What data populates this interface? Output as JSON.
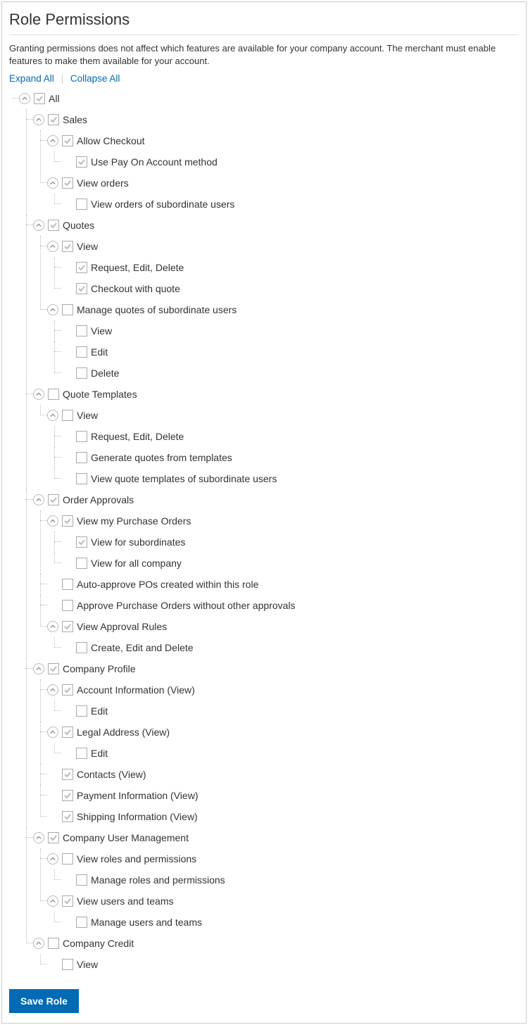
{
  "title": "Role Permissions",
  "description": "Granting permissions does not affect which features are available for your company account. The merchant must enable features to make them available for your account.",
  "toolbar": {
    "expand": "Expand All",
    "collapse": "Collapse All"
  },
  "save_label": "Save Role",
  "tree": [
    {
      "label": "All",
      "checked": true,
      "expandable": true,
      "children": [
        {
          "label": "Sales",
          "checked": true,
          "expandable": true,
          "children": [
            {
              "label": "Allow Checkout",
              "checked": true,
              "expandable": true,
              "children": [
                {
                  "label": "Use Pay On Account method",
                  "checked": true
                }
              ]
            },
            {
              "label": "View orders",
              "checked": true,
              "expandable": true,
              "children": [
                {
                  "label": "View orders of subordinate users",
                  "checked": false
                }
              ]
            }
          ]
        },
        {
          "label": "Quotes",
          "checked": true,
          "expandable": true,
          "children": [
            {
              "label": "View",
              "checked": true,
              "expandable": true,
              "children": [
                {
                  "label": "Request, Edit, Delete",
                  "checked": true
                },
                {
                  "label": "Checkout with quote",
                  "checked": true
                }
              ]
            },
            {
              "label": "Manage quotes of subordinate users",
              "checked": false,
              "expandable": true,
              "children": [
                {
                  "label": "View",
                  "checked": false
                },
                {
                  "label": "Edit",
                  "checked": false
                },
                {
                  "label": "Delete",
                  "checked": false
                }
              ]
            }
          ]
        },
        {
          "label": "Quote Templates",
          "checked": false,
          "expandable": true,
          "children": [
            {
              "label": "View",
              "checked": false,
              "expandable": true,
              "children": [
                {
                  "label": "Request, Edit, Delete",
                  "checked": false
                },
                {
                  "label": "Generate quotes from templates",
                  "checked": false
                },
                {
                  "label": "View quote templates of subordinate users",
                  "checked": false
                }
              ]
            }
          ]
        },
        {
          "label": "Order Approvals",
          "checked": true,
          "expandable": true,
          "children": [
            {
              "label": "View my Purchase Orders",
              "checked": true,
              "expandable": true,
              "children": [
                {
                  "label": "View for subordinates",
                  "checked": true
                },
                {
                  "label": "View for all company",
                  "checked": false
                }
              ]
            },
            {
              "label": "Auto-approve POs created within this role",
              "checked": false
            },
            {
              "label": "Approve Purchase Orders without other approvals",
              "checked": false
            },
            {
              "label": "View Approval Rules",
              "checked": true,
              "expandable": true,
              "children": [
                {
                  "label": "Create, Edit and Delete",
                  "checked": false
                }
              ]
            }
          ]
        },
        {
          "label": "Company Profile",
          "checked": true,
          "expandable": true,
          "children": [
            {
              "label": "Account Information (View)",
              "checked": true,
              "expandable": true,
              "children": [
                {
                  "label": "Edit",
                  "checked": false
                }
              ]
            },
            {
              "label": "Legal Address (View)",
              "checked": true,
              "expandable": true,
              "children": [
                {
                  "label": "Edit",
                  "checked": false
                }
              ]
            },
            {
              "label": "Contacts (View)",
              "checked": true
            },
            {
              "label": "Payment Information (View)",
              "checked": true
            },
            {
              "label": "Shipping Information (View)",
              "checked": true
            }
          ]
        },
        {
          "label": "Company User Management",
          "checked": true,
          "expandable": true,
          "children": [
            {
              "label": "View roles and permissions",
              "checked": false,
              "expandable": true,
              "children": [
                {
                  "label": "Manage roles and permissions",
                  "checked": false
                }
              ]
            },
            {
              "label": "View users and teams",
              "checked": true,
              "expandable": true,
              "children": [
                {
                  "label": "Manage users and teams",
                  "checked": false
                }
              ]
            }
          ]
        },
        {
          "label": "Company Credit",
          "checked": false,
          "expandable": true,
          "children": [
            {
              "label": "View",
              "checked": false
            }
          ]
        }
      ]
    }
  ]
}
